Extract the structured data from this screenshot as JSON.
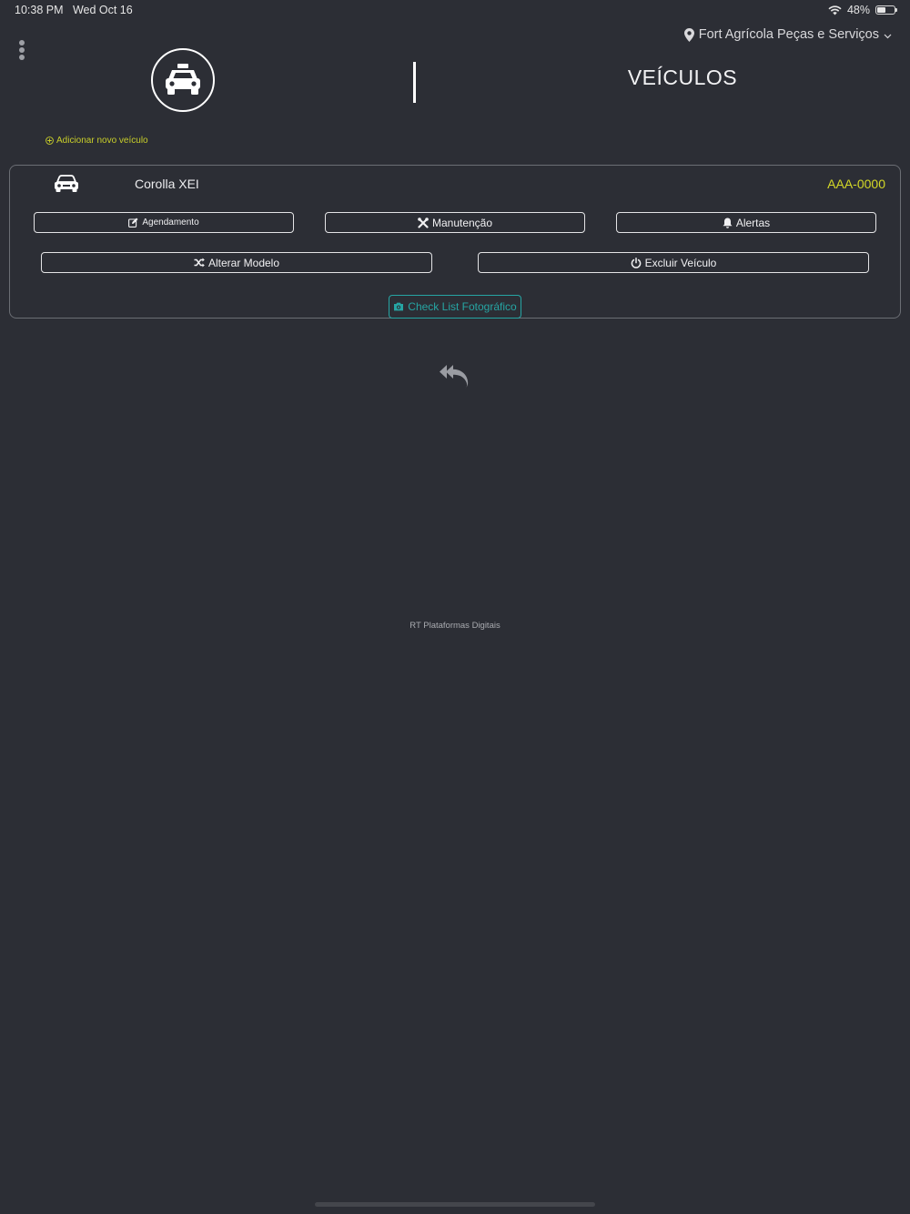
{
  "status_bar": {
    "time": "10:38 PM",
    "date": "Wed Oct 16",
    "battery_text": "48%",
    "battery_level": 0.48
  },
  "header": {
    "location": "Fort Agrícola Peças e Serviços",
    "title": "VEÍCULOS"
  },
  "add_vehicle_link": "Adicionar novo veículo",
  "vehicle": {
    "model": "Corolla XEI",
    "plate": "AAA-0000",
    "actions": {
      "schedule": "Agendamento",
      "maintenance": "Manutenção",
      "alerts": "Alertas",
      "change_model": "Alterar Modelo",
      "delete": "Excluir Veículo",
      "checklist": "Check List Fotográfico"
    }
  },
  "footer": "RT Plataformas Digitais",
  "colors": {
    "background": "#2c2e35",
    "accent_yellow": "#d4d827",
    "accent_teal": "#26a5a3",
    "text": "#f0f0f2"
  },
  "icons": {
    "menu": "kebab-menu-icon",
    "location": "map-pin-icon",
    "header": "taxi-icon",
    "vehicle": "car-icon",
    "schedule": "edit-icon",
    "maintenance": "tools-icon",
    "alerts": "bell-icon",
    "change_model": "shuffle-icon",
    "delete": "power-icon",
    "checklist": "camera-icon",
    "back": "reply-all-icon"
  }
}
